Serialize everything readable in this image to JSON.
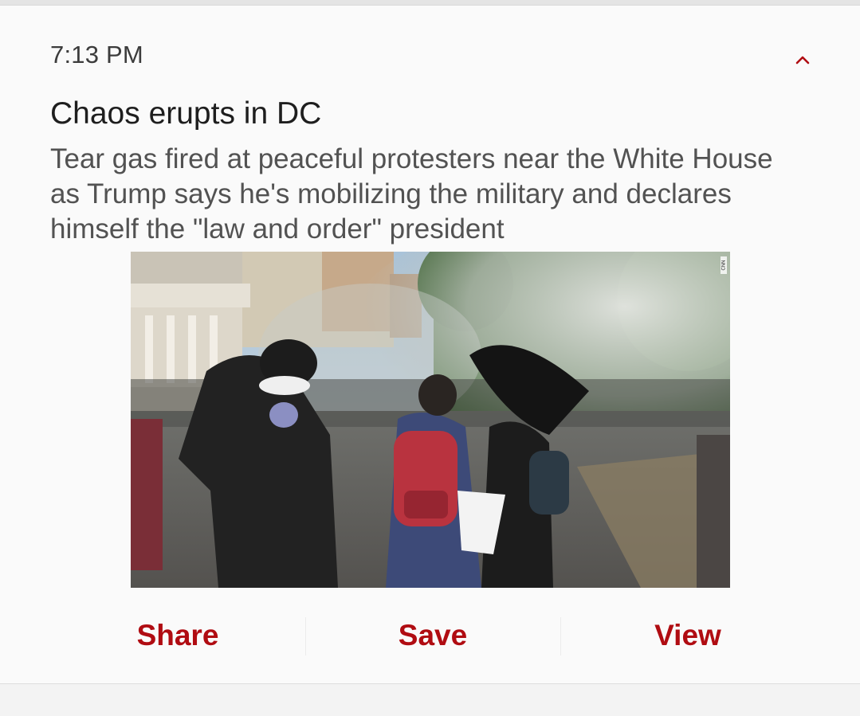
{
  "notification": {
    "time": "7:13 PM",
    "title": "Chaos erupts in DC",
    "body": "Tear gas fired at peaceful protesters near the White House as Trump says he's mobilizing the military and declares himself the \"law and order\" president",
    "collapse_icon": "chevron-up-icon",
    "image_watermark": "CNN"
  },
  "actions": [
    {
      "label": "Share"
    },
    {
      "label": "Save"
    },
    {
      "label": "View"
    }
  ],
  "colors": {
    "accent": "#b00c12",
    "card_background": "#fafafa",
    "title_text": "#1e1e1e",
    "body_text": "#525252"
  }
}
